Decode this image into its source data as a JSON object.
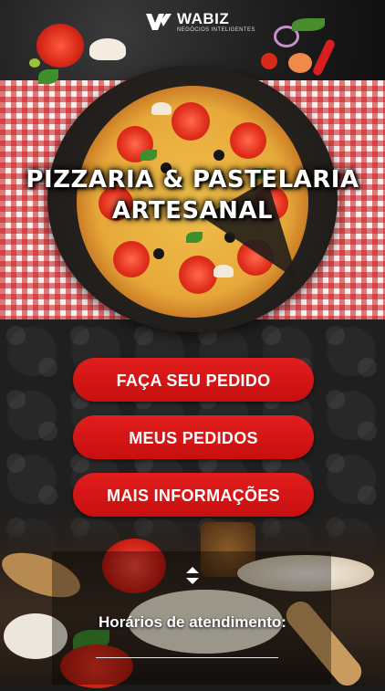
{
  "logo": {
    "name": "WABIZ",
    "tagline": "NEGÓCIOS INTELIGENTES"
  },
  "title": {
    "line1": "PIZZARIA & PASTELARIA",
    "line2": "ARTESANAL"
  },
  "menu": {
    "order_label": "FAÇA SEU PEDIDO",
    "my_orders_label": "MEUS PEDIDOS",
    "more_info_label": "MAIS INFORMAÇÕES"
  },
  "hours": {
    "label": "Horários de atendimento:"
  },
  "colors": {
    "button_red": "#d51616",
    "checker_red": "#cd161c",
    "text_white": "#ffffff"
  },
  "icons": {
    "scroll": "up-down-arrows-icon"
  }
}
